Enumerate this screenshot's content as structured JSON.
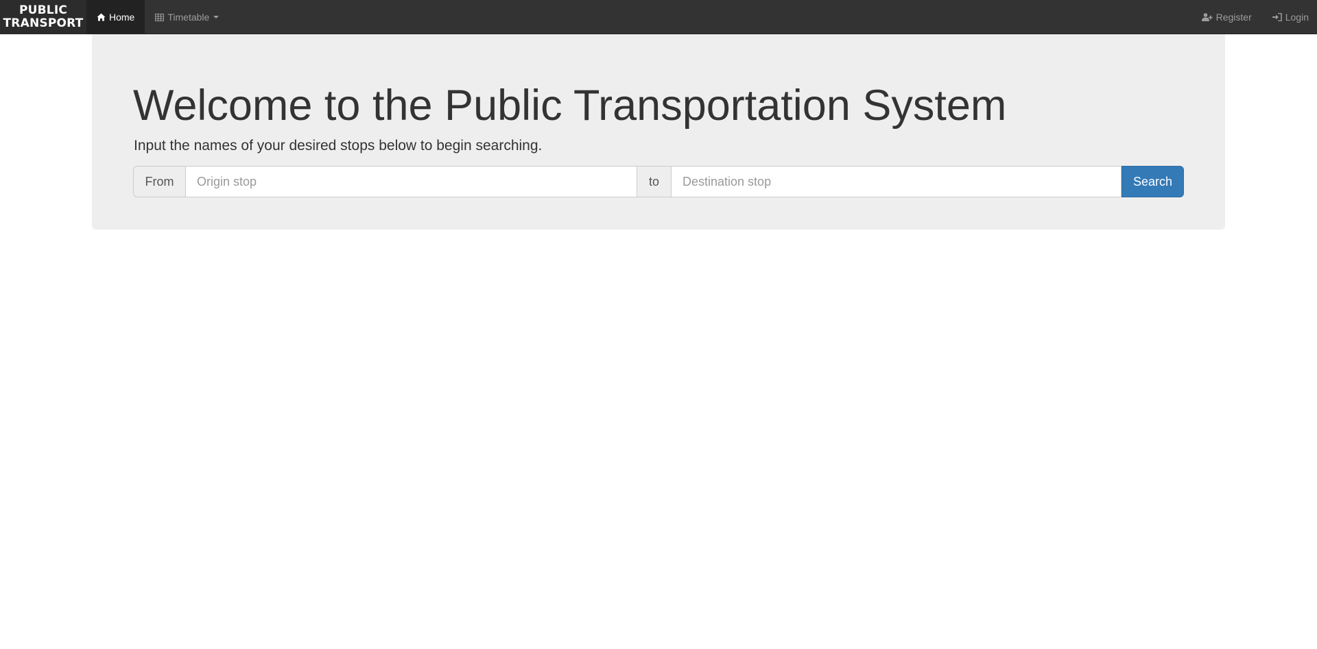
{
  "navbar": {
    "brand_line1": "PUBLIC",
    "brand_line2": "TRANSPORT",
    "items": [
      {
        "label": "Home",
        "icon": "home-icon",
        "active": true
      },
      {
        "label": "Timetable",
        "icon": "table-icon",
        "dropdown": true
      }
    ],
    "right_items": [
      {
        "label": "Register",
        "icon": "user-plus-icon"
      },
      {
        "label": "Login",
        "icon": "sign-in-icon"
      }
    ],
    "colors": {
      "background": "#333333",
      "active_background": "#222222",
      "text": "#9d9d9d",
      "active_text": "#ffffff"
    }
  },
  "hero": {
    "title": "Welcome to the Public Transportation System",
    "subtitle": "Input the names of your desired stops below to begin searching.",
    "background": "#eeeeee"
  },
  "search": {
    "from_label": "From",
    "origin_placeholder": "Origin stop",
    "origin_value": "",
    "to_label": "to",
    "destination_placeholder": "Destination stop",
    "destination_value": "",
    "button_label": "Search",
    "button_color": "#337ab7"
  }
}
